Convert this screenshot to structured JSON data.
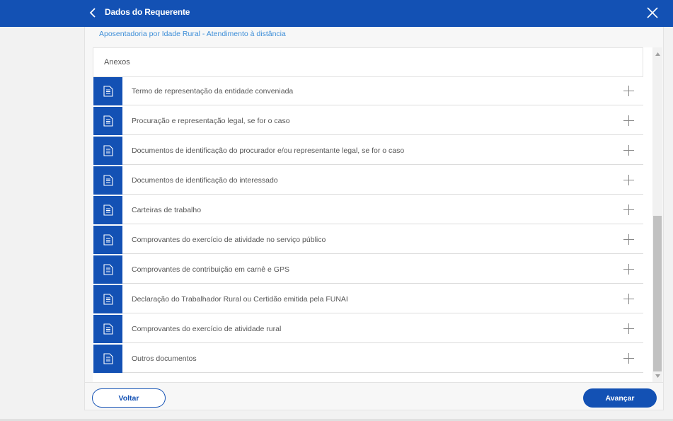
{
  "header": {
    "title": "Dados do Requerente",
    "back_icon": "chevron-left-icon",
    "close_icon": "close-icon",
    "color": "#1351b4"
  },
  "service": {
    "subtitle": "Aposentadoria por Idade Rural - Atendimento à distância"
  },
  "annexes": {
    "title": "Anexos",
    "item_icon": "document-icon",
    "action_icon": "plus-icon",
    "items": [
      {
        "label": "Termo de representação da entidade conveniada"
      },
      {
        "label": "Procuração e representação legal, se for o caso"
      },
      {
        "label": "Documentos de identificação do procurador e/ou representante legal, se for o caso"
      },
      {
        "label": "Documentos de identificação do interessado"
      },
      {
        "label": "Carteiras de trabalho"
      },
      {
        "label": "Comprovantes do exercício de atividade no serviço público"
      },
      {
        "label": "Comprovantes de contribuição em carnê e GPS"
      },
      {
        "label": "Declaração do Trabalhador Rural ou Certidão emitida pela FUNAI"
      },
      {
        "label": "Comprovantes do exercício de atividade rural"
      },
      {
        "label": "Outros documentos"
      }
    ]
  },
  "footer": {
    "back_label": "Voltar",
    "next_label": "Avançar"
  }
}
